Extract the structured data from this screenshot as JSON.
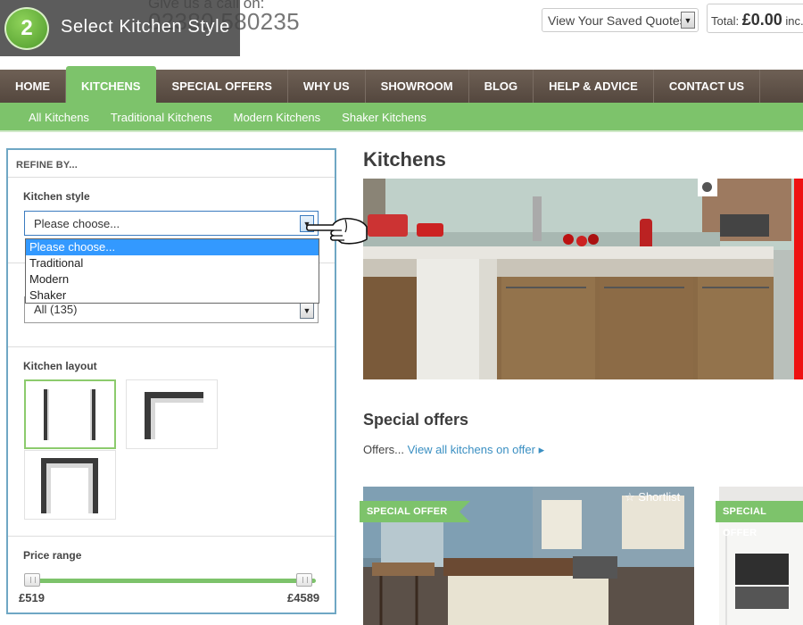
{
  "header": {
    "call_prefix": "Give us a call on:",
    "phone": "02380 580235",
    "saved_quotes": "View Your Saved Quotes",
    "total_label": "Total:",
    "total_amount": "£0.00",
    "total_suffix": "inc."
  },
  "step": {
    "number": "2",
    "label": "Select Kitchen Style"
  },
  "nav": {
    "items": [
      "HOME",
      "KITCHENS",
      "SPECIAL OFFERS",
      "WHY US",
      "SHOWROOM",
      "BLOG",
      "HELP & ADVICE",
      "CONTACT US"
    ],
    "active": "KITCHENS"
  },
  "subnav": {
    "items": [
      "All Kitchens",
      "Traditional Kitchens",
      "Modern Kitchens",
      "Shaker Kitchens"
    ]
  },
  "refine": {
    "title": "REFINE BY...",
    "style_label": "Kitchen style",
    "style_value": "Please choose...",
    "style_options": [
      "Please choose...",
      "Traditional",
      "Modern",
      "Shaker"
    ],
    "second_select_value": "All (135)",
    "layout_label": "Kitchen layout",
    "price_label": "Price range",
    "price_min": "£519",
    "price_max": "£4589"
  },
  "content": {
    "title": "Kitchens",
    "special_title": "Special offers",
    "offers_prefix": "Offers...",
    "offers_link": "View all kitchens on offer",
    "ribbon_label": "SPECIAL OFFER",
    "shortlist_label": "Shortlist"
  },
  "colors": {
    "brown_nav": "#5e5147",
    "green_accent": "#7dc36b",
    "panel_border": "#6fa7c4",
    "link": "#3a8fc2"
  }
}
